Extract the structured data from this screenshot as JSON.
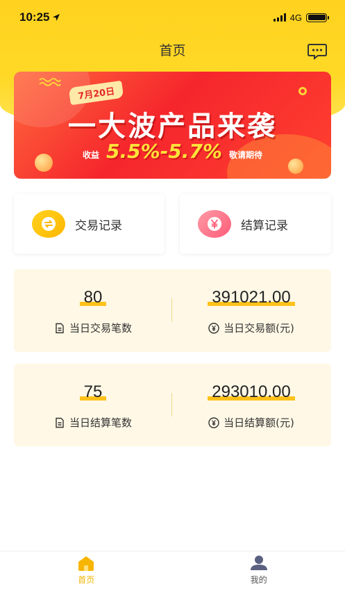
{
  "status_bar": {
    "time": "10:25",
    "network": "4G"
  },
  "nav": {
    "title": "首页"
  },
  "banner": {
    "tag": "7月20日",
    "headline": "一大波产品来袭",
    "yield_label": "收益",
    "rate": "5.5%-5.7%",
    "stay_tuned": "敬请期待",
    "accent_color": "#f5262c"
  },
  "quick_actions": [
    {
      "label": "交易记录",
      "icon": "exchange-icon"
    },
    {
      "label": "结算记录",
      "icon": "yen-icon"
    }
  ],
  "stats": [
    {
      "left": {
        "value": "80",
        "caption": "当日交易笔数"
      },
      "right": {
        "value": "391021.00",
        "caption": "当日交易额(元)"
      }
    },
    {
      "left": {
        "value": "75",
        "caption": "当日结算笔数"
      },
      "right": {
        "value": "293010.00",
        "caption": "当日结算额(元)"
      }
    }
  ],
  "tabbar": {
    "home": "首页",
    "me": "我的",
    "active": "home",
    "active_color": "#f2b400"
  }
}
